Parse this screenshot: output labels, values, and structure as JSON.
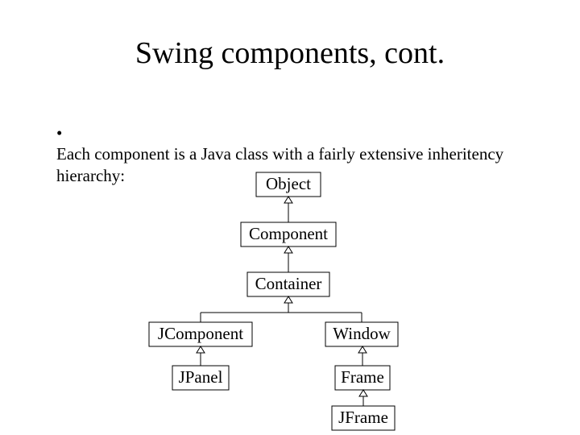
{
  "title": "Swing components, cont.",
  "bullet": "Each component is a Java class with a fairly extensive inheritency hierarchy:",
  "nodes": {
    "object": {
      "label": "Object"
    },
    "component": {
      "label": "Component"
    },
    "container": {
      "label": "Container"
    },
    "jcomponent": {
      "label": "JComponent"
    },
    "window": {
      "label": "Window"
    },
    "jpanel": {
      "label": "JPanel"
    },
    "frame": {
      "label": "Frame"
    },
    "jframe": {
      "label": "JFrame"
    }
  }
}
